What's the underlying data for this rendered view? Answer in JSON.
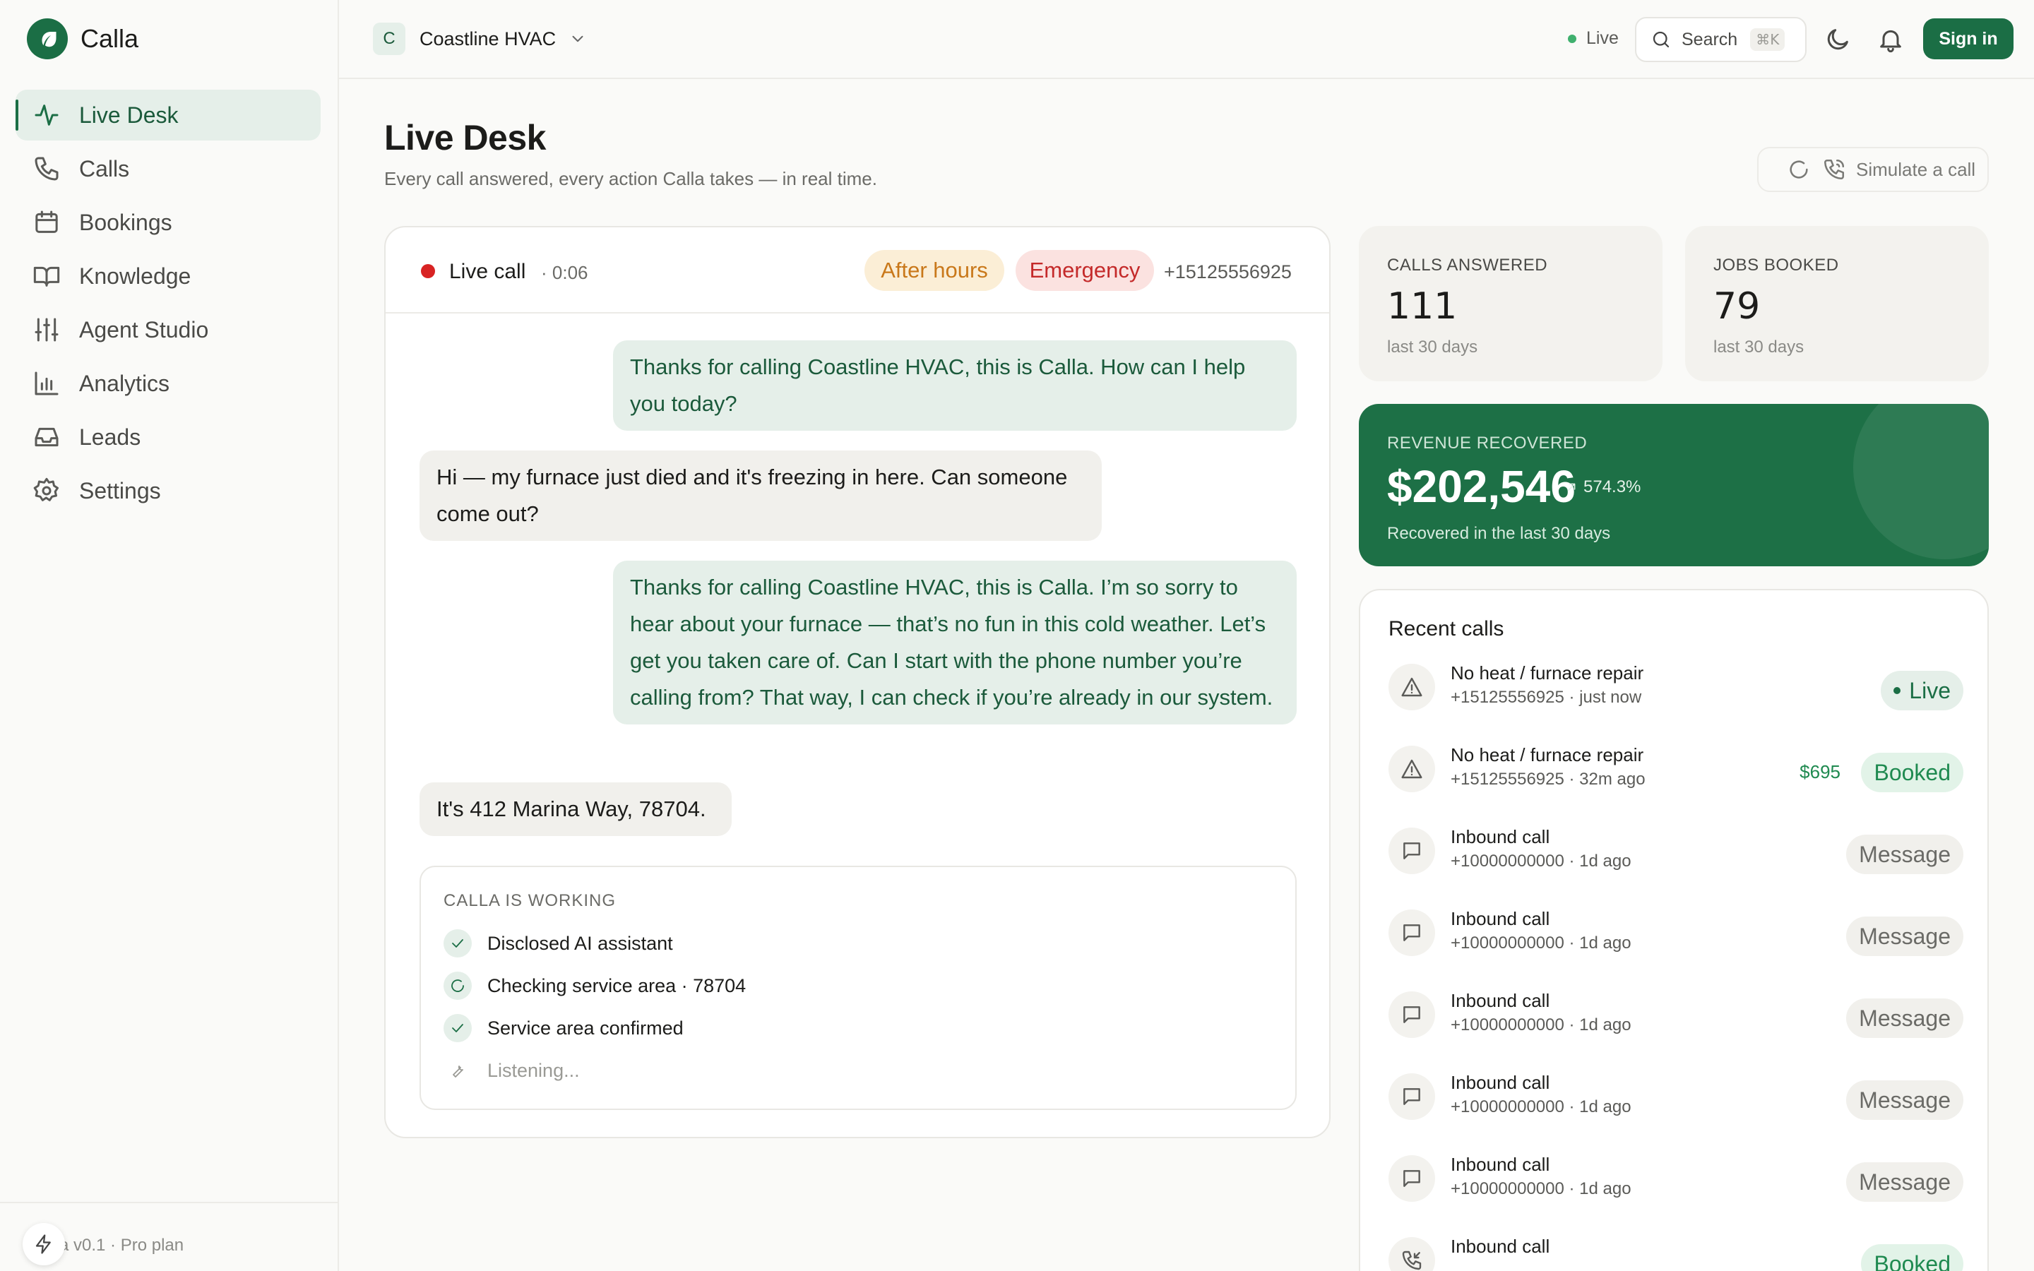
{
  "brand": {
    "name": "Calla"
  },
  "nav": [
    {
      "label": "Live Desk",
      "icon": "activity-icon",
      "active": true
    },
    {
      "label": "Calls",
      "icon": "phone-icon"
    },
    {
      "label": "Bookings",
      "icon": "calendar-icon"
    },
    {
      "label": "Knowledge",
      "icon": "book-icon"
    },
    {
      "label": "Agent Studio",
      "icon": "sliders-icon"
    },
    {
      "label": "Analytics",
      "icon": "bar-chart-icon"
    },
    {
      "label": "Leads",
      "icon": "inbox-icon"
    },
    {
      "label": "Settings",
      "icon": "gear-icon"
    }
  ],
  "footer": {
    "text": "a v0.1 · Pro plan"
  },
  "topbar": {
    "org_initial": "C",
    "org_name": "Coastline HVAC",
    "live_label": "Live",
    "search_label": "Search",
    "search_shortcut": "⌘K",
    "signin_label": "Sign in"
  },
  "page": {
    "title": "Live Desk",
    "subtitle": "Every call answered, every action Calla takes — in real time.",
    "simulate_label": "Simulate a call"
  },
  "call": {
    "status_label": "Live call",
    "duration": "· 0:06",
    "tags": [
      "After hours",
      "Emergency"
    ],
    "phone": "+15125556925",
    "messages": [
      {
        "from": "agent",
        "text": "Thanks for calling Coastline HVAC, this is Calla. How can I help you today?"
      },
      {
        "from": "caller",
        "text": "Hi — my furnace just died and it's freezing in here. Can someone come out?"
      },
      {
        "from": "agent",
        "text": "Thanks for calling Coastline HVAC, this is Calla. I’m so sorry to hear about your furnace — that’s no fun in this cold weather. Let’s get you taken care of. Can I start with the phone number you’re calling from? That way, I can check if you’re already in our system."
      },
      {
        "from": "caller",
        "text": "It's 412 Marina Way, 78704."
      }
    ],
    "working": {
      "title": "CALLA IS WORKING",
      "steps": [
        {
          "label": "Disclosed AI assistant",
          "state": "done"
        },
        {
          "label": "Checking service area · 78704",
          "state": "running"
        },
        {
          "label": "Service area confirmed",
          "state": "done"
        },
        {
          "label": "Listening...",
          "state": "pending"
        }
      ]
    }
  },
  "stats": [
    {
      "label": "CALLS ANSWERED",
      "value": "111",
      "note": "last 30 days"
    },
    {
      "label": "JOBS BOOKED",
      "value": "79",
      "note": "last 30 days"
    }
  ],
  "revenue": {
    "label": "REVENUE RECOVERED",
    "value": "$202,546",
    "trend": "574.3%",
    "note": "Recovered in the last 30 days"
  },
  "recent": {
    "title": "Recent calls",
    "rows": [
      {
        "icon": "alert-triangle-icon",
        "title": "No heat / furnace repair",
        "sub": "+15125556925 · just now",
        "status": "Live",
        "kind": "live",
        "amount": ""
      },
      {
        "icon": "alert-triangle-icon",
        "title": "No heat / furnace repair",
        "sub": "+15125556925 · 32m ago",
        "status": "Booked",
        "kind": "booked",
        "amount": "$695"
      },
      {
        "icon": "message-icon",
        "title": "Inbound call",
        "sub": "+10000000000 · 1d ago",
        "status": "Message",
        "kind": "msg",
        "amount": ""
      },
      {
        "icon": "message-icon",
        "title": "Inbound call",
        "sub": "+10000000000 · 1d ago",
        "status": "Message",
        "kind": "msg",
        "amount": ""
      },
      {
        "icon": "message-icon",
        "title": "Inbound call",
        "sub": "+10000000000 · 1d ago",
        "status": "Message",
        "kind": "msg",
        "amount": ""
      },
      {
        "icon": "message-icon",
        "title": "Inbound call",
        "sub": "+10000000000 · 1d ago",
        "status": "Message",
        "kind": "msg",
        "amount": ""
      },
      {
        "icon": "message-icon",
        "title": "Inbound call",
        "sub": "+10000000000 · 1d ago",
        "status": "Message",
        "kind": "msg",
        "amount": ""
      },
      {
        "icon": "phone-incoming-icon",
        "title": "Inbound call",
        "sub": "",
        "status": "Booked",
        "kind": "booked",
        "amount": ""
      }
    ]
  },
  "colors": {
    "accent": "#1b6e45",
    "accent_soft": "#e5efe9",
    "live_dot": "#3fb06e",
    "recording": "#d82323",
    "warning": "#c9781a",
    "danger": "#c42a2a"
  }
}
